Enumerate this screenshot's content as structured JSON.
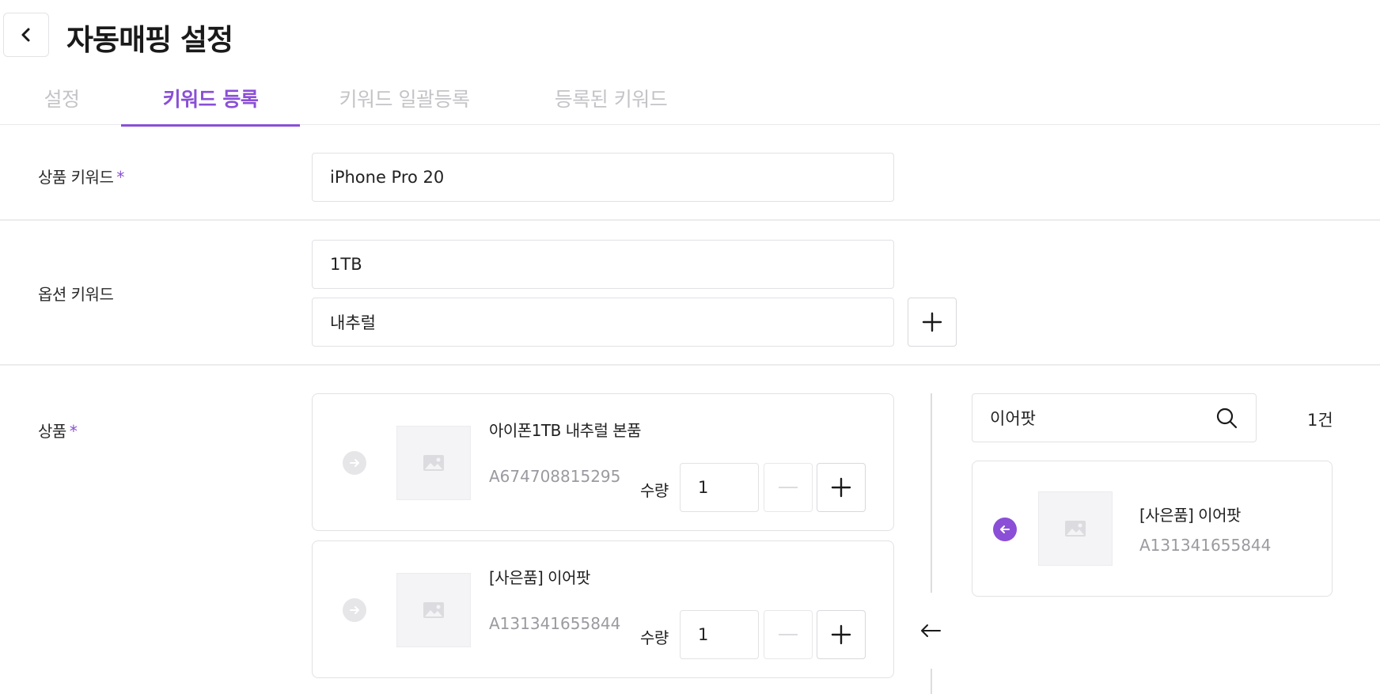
{
  "header": {
    "title": "자동매핑 설정"
  },
  "tabs": [
    {
      "label": "설정"
    },
    {
      "label": "키워드 등록"
    },
    {
      "label": "키워드 일괄등록"
    },
    {
      "label": "등록된 키워드"
    }
  ],
  "product_keyword": {
    "label": "상품 키워드",
    "required_mark": "*",
    "value": "iPhone Pro 20"
  },
  "option_keyword": {
    "label": "옵션 키워드",
    "values": [
      "1TB",
      "내추럴"
    ]
  },
  "products": {
    "label": "상품",
    "required_mark": "*",
    "selected": [
      {
        "name": "아이폰1TB 내추럴 본품",
        "code": "A674708815295",
        "qty_label": "수량",
        "qty": "1"
      },
      {
        "name": "[사은품] 이어팟",
        "code": "A131341655844",
        "qty_label": "수량",
        "qty": "1"
      }
    ],
    "search": {
      "value": "이어팟",
      "count": "1건"
    },
    "results": [
      {
        "name": "[사은품] 이어팟",
        "code": "A131341655844"
      }
    ]
  },
  "colors": {
    "accent": "#8a4fd6",
    "muted": "#c4c4c8",
    "border": "#e2e2e6"
  }
}
